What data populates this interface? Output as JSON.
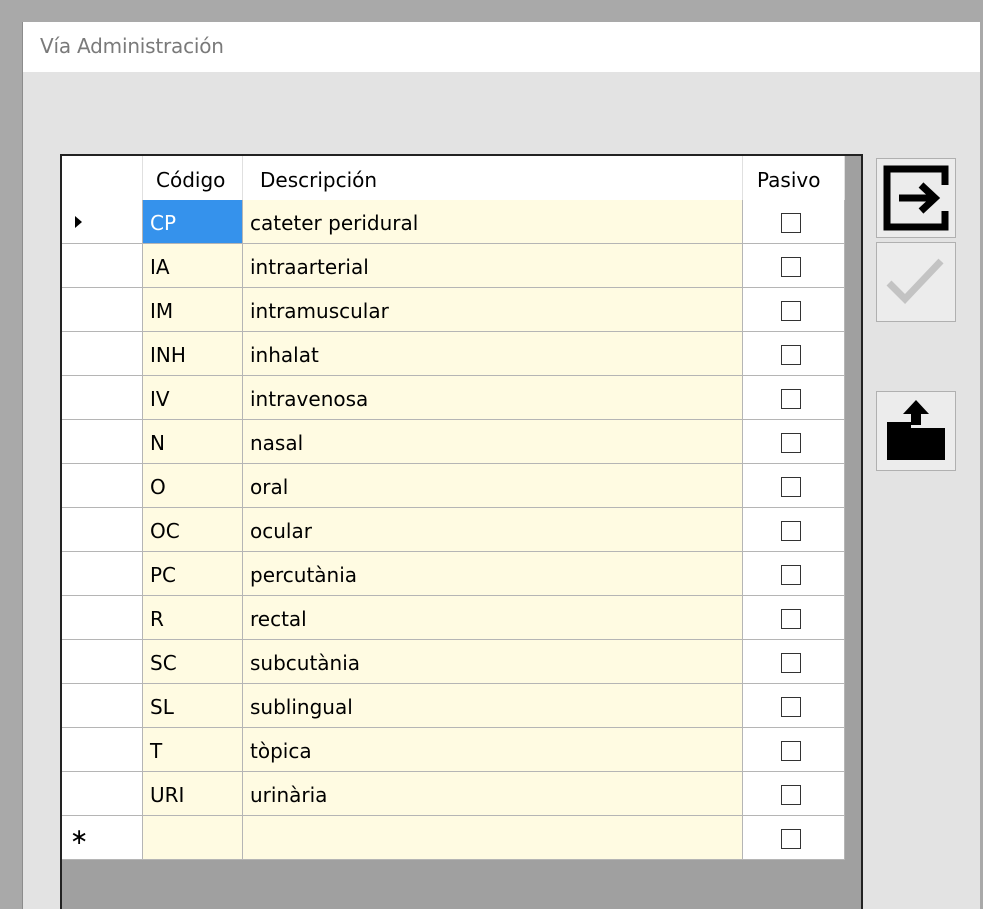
{
  "window": {
    "title": "Vía Administración"
  },
  "grid": {
    "headers": {
      "code": "Código",
      "description": "Descripción",
      "passive": "Pasivo"
    },
    "rows": [
      {
        "code": "CP",
        "description": "cateter peridural",
        "passive": false
      },
      {
        "code": "IA",
        "description": "intraarterial",
        "passive": false
      },
      {
        "code": "IM",
        "description": "intramuscular",
        "passive": false
      },
      {
        "code": "INH",
        "description": "inhalat",
        "passive": false
      },
      {
        "code": "IV",
        "description": "intravenosa",
        "passive": false
      },
      {
        "code": "N",
        "description": "nasal",
        "passive": false
      },
      {
        "code": "O",
        "description": "oral",
        "passive": false
      },
      {
        "code": "OC",
        "description": "ocular",
        "passive": false
      },
      {
        "code": "PC",
        "description": "percutània",
        "passive": false
      },
      {
        "code": "R",
        "description": "rectal",
        "passive": false
      },
      {
        "code": "SC",
        "description": "subcutània",
        "passive": false
      },
      {
        "code": "SL",
        "description": "sublingual",
        "passive": false
      },
      {
        "code": "T",
        "description": "tòpica",
        "passive": false
      },
      {
        "code": "URI",
        "description": "urinària",
        "passive": false
      }
    ],
    "new_row_marker": "∗",
    "current_row_index": 0
  },
  "toolbar": {
    "exit_icon": "exit-arrow-icon",
    "accept_icon": "checkmark-icon",
    "export_icon": "open-folder-upload-icon"
  },
  "colors": {
    "cell_background": "#fffbe2",
    "selected_cell": "#3592ec",
    "grid_background": "#a0a0a0",
    "window_background": "#e3e3e3"
  }
}
